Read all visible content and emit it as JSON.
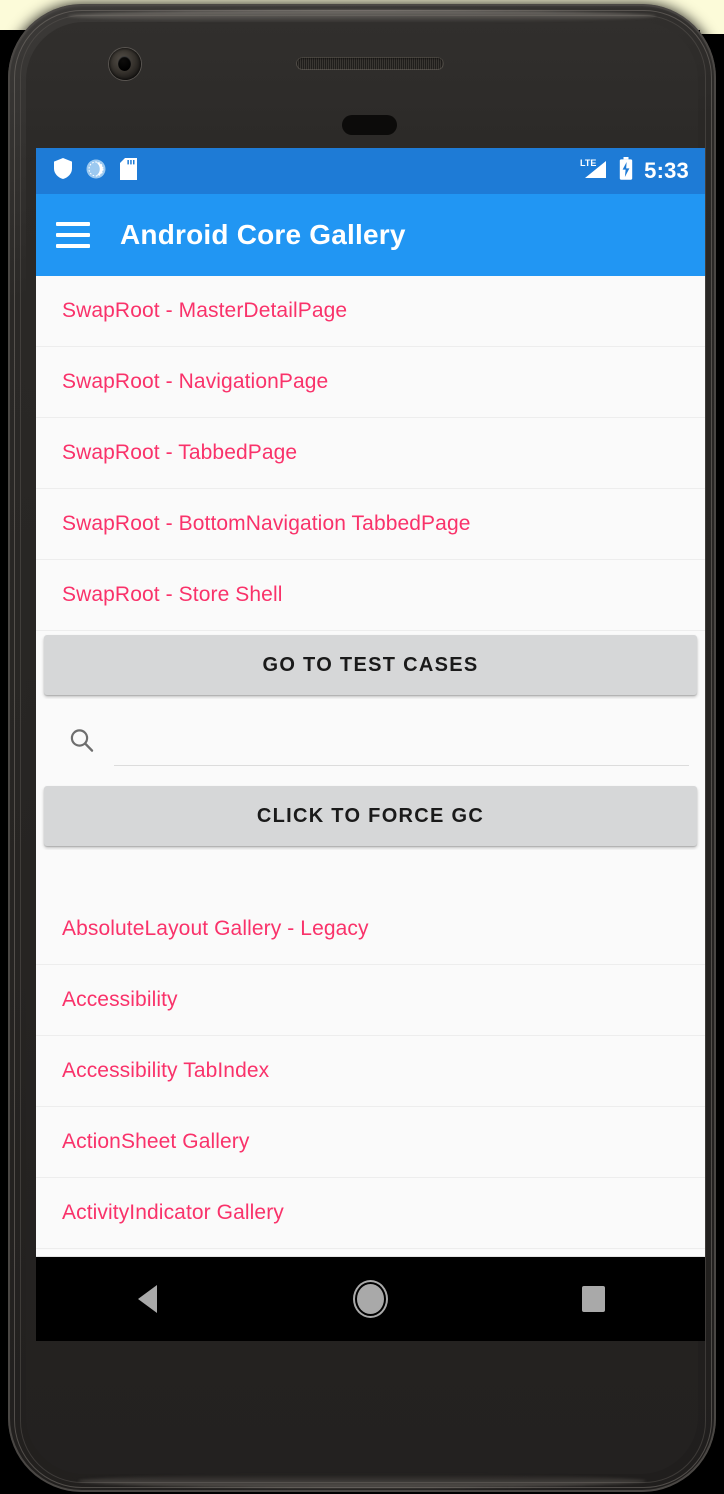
{
  "device": {
    "frame_color": "#2a2826",
    "backdrop_color": "#000000",
    "accent_cream": "#FCFBD9"
  },
  "status_bar": {
    "background": "#1E7BD6",
    "left_icons": [
      "shield-icon",
      "medal-icon",
      "sd-card-icon"
    ],
    "network_label": "LTE",
    "right_icons": [
      "lte-signal-icon",
      "battery-charging-icon"
    ],
    "time": "5:33"
  },
  "app_bar": {
    "background": "#2196F3",
    "menu_icon": "hamburger-menu-icon",
    "title": "Android Core Gallery"
  },
  "theme": {
    "link_color": "#F9326A",
    "page_background": "#FAFAFA",
    "button_background": "#D6D7D8",
    "button_text": "#1A1A1A",
    "divider": "#EDEDED"
  },
  "swap_root_list": [
    {
      "label": "SwapRoot - MasterDetailPage"
    },
    {
      "label": "SwapRoot - NavigationPage"
    },
    {
      "label": "SwapRoot - TabbedPage"
    },
    {
      "label": "SwapRoot - BottomNavigation TabbedPage"
    },
    {
      "label": "SwapRoot - Store Shell"
    }
  ],
  "test_cases_button": {
    "label": "GO TO TEST CASES"
  },
  "search": {
    "icon": "search-icon",
    "value": "",
    "placeholder": ""
  },
  "gc_button": {
    "label": "CLICK TO FORCE GC"
  },
  "gallery_list": [
    {
      "label": "AbsoluteLayout Gallery - Legacy"
    },
    {
      "label": "Accessibility"
    },
    {
      "label": "Accessibility TabIndex"
    },
    {
      "label": "ActionSheet Gallery"
    },
    {
      "label": "ActivityIndicator Gallery"
    }
  ],
  "nav_bar": {
    "background": "#000000",
    "back_label": "Back",
    "home_label": "Home",
    "recents_label": "Recents"
  }
}
